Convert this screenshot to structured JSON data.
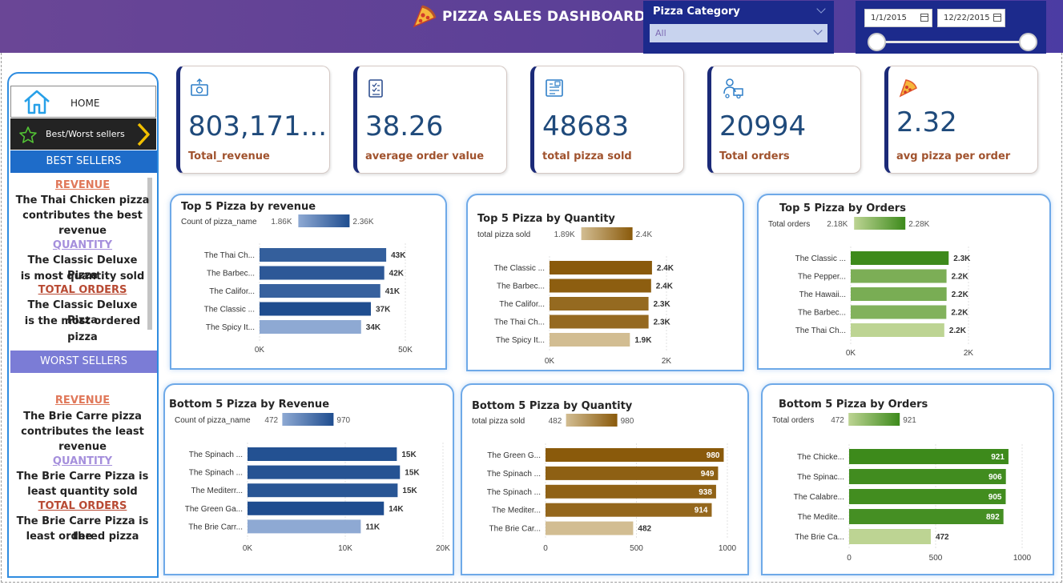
{
  "header": {
    "title": "PIZZA SALES DASHBOARD",
    "category_slicer": {
      "label": "Pizza Category",
      "value": "All"
    },
    "date_range": {
      "start": "1/1/2015",
      "end": "12/22/2015"
    }
  },
  "sidebar": {
    "home_label": "HOME",
    "bw_label": "Best/Worst sellers",
    "best_sellers": {
      "title": "BEST SELLERS",
      "revenue_head": "REVENUE",
      "revenue_lines": [
        "The Thai Chicken pizza",
        "contributes the best",
        "revenue"
      ],
      "quantity_head": "QUANTITY",
      "quantity_lines": [
        "The Classic Deluxe Pizza",
        "is most quantity sold"
      ],
      "orders_head": "TOTAL ORDERS",
      "orders_lines": [
        "The Classic Deluxe Pizza",
        "is the most ordered",
        "pizza"
      ]
    },
    "worst_sellers": {
      "title": "WORST SELLERS",
      "revenue_head": "REVENUE",
      "revenue_lines": [
        "The Brie Carre pizza",
        "contributes the least",
        "revenue"
      ],
      "quantity_head": "QUANTITY",
      "quantity_lines": [
        "The Brie Carre Pizza is",
        "least quantity sold"
      ],
      "orders_head": "TOTAL ORDERS",
      "orders_lines": [
        "The Brie Carre Pizza is the",
        "least ordered pizza"
      ]
    }
  },
  "kpis": [
    {
      "value": "803,171....",
      "label": "Total_revenue"
    },
    {
      "value": "38.26",
      "label": "average order value"
    },
    {
      "value": "48683",
      "label": "total pizza sold"
    },
    {
      "value": "20994",
      "label": "Total orders"
    },
    {
      "value": "2.32",
      "label": "avg pizza per order"
    }
  ],
  "colors": {
    "header": "#5a3f97",
    "slicer": "#1c2a8c",
    "blue_dark": "#1f4d8f",
    "blue_light": "#8ea9d3",
    "gold_dark": "#8a5a0b",
    "gold_light": "#d2bd92",
    "green_dark": "#3d8a1b",
    "green_light": "#bdd493",
    "kpi_label": "#a0522d"
  },
  "chart_data": [
    {
      "type": "bar",
      "orientation": "horizontal",
      "title": "Top 5 Pizza by revenue",
      "legend": {
        "label": "Count of pizza_name",
        "min_label": "1.86K",
        "max_label": "2.36K"
      },
      "categories": [
        "The Thai Ch...",
        "The Barbec...",
        "The Califor...",
        "The Classic ...",
        "The Spicy It..."
      ],
      "values": [
        43434,
        42768,
        41410,
        38180,
        34831
      ],
      "color_values": [
        2315,
        2350,
        2302,
        2416,
        1887
      ],
      "data_labels": [
        "43K",
        "42K",
        "41K",
        "37K",
        "34K"
      ],
      "xlim": [
        0,
        50000
      ],
      "xticks": [
        "0K",
        "50K"
      ],
      "palette": "blue"
    },
    {
      "type": "bar",
      "orientation": "horizontal",
      "title": "Top 5 Pizza by Quantity",
      "legend": {
        "label": "total pizza sold",
        "min_label": "1.89K",
        "max_label": "2.4K"
      },
      "categories": [
        "The Classic ...",
        "The Barbec...",
        "The Califor...",
        "The Thai Ch...",
        "The Spicy It..."
      ],
      "values": [
        2453,
        2432,
        2370,
        2371,
        1924
      ],
      "color_values": [
        2453,
        2432,
        2370,
        2371,
        1924
      ],
      "data_labels": [
        "2.4K",
        "2.4K",
        "2.3K",
        "2.3K",
        "1.9K"
      ],
      "xlim": [
        0,
        2800
      ],
      "xticks": [
        "0K",
        "2K"
      ],
      "palette": "gold"
    },
    {
      "type": "bar",
      "orientation": "horizontal",
      "title": "Top 5 Pizza by Orders",
      "legend": {
        "label": "Total orders",
        "min_label": "2.18K",
        "max_label": "2.28K"
      },
      "categories": [
        "The Classic ...",
        "The Pepper...",
        "The Hawaii...",
        "The Barbec...",
        "The Thai Ch..."
      ],
      "values": [
        2329,
        2278,
        2280,
        2273,
        2225
      ],
      "color_values": [
        2329,
        2278,
        2280,
        2273,
        2225
      ],
      "data_labels": [
        "2.3K",
        "2.2K",
        "2.2K",
        "2.2K",
        "2.2K"
      ],
      "xlim": [
        0,
        2800
      ],
      "xticks": [
        "0K",
        "2K"
      ],
      "palette": "green"
    },
    {
      "type": "bar",
      "orientation": "horizontal",
      "title": "Bottom 5 Pizza by Revenue",
      "legend": {
        "label": "Count of pizza_name",
        "min_label": "472",
        "max_label": "970"
      },
      "categories": [
        "The Spinach ...",
        "The Spinach ...",
        "The Mediterr...",
        "The Green Ga...",
        "The Brie Carr..."
      ],
      "values": [
        15277,
        15596,
        15360,
        13955,
        11588
      ],
      "color_values": [
        950,
        940,
        923,
        970,
        472
      ],
      "data_labels": [
        "15K",
        "15K",
        "15K",
        "14K",
        "11K"
      ],
      "xlim": [
        0,
        20000
      ],
      "xticks": [
        "0K",
        "10K",
        "20K"
      ],
      "palette": "blue"
    },
    {
      "type": "bar",
      "orientation": "horizontal",
      "title": "Bottom 5 Pizza by Quantity",
      "legend": {
        "label": "total pizza sold",
        "min_label": "482",
        "max_label": "980"
      },
      "categories": [
        "The Green G...",
        "The Spinach ...",
        "The Spinach ...",
        "The Mediter...",
        "The Brie Car..."
      ],
      "values": [
        980,
        949,
        938,
        914,
        482
      ],
      "color_values": [
        980,
        949,
        938,
        914,
        482
      ],
      "data_labels": [
        "980",
        "949",
        "938",
        "914",
        "482"
      ],
      "xlim": [
        0,
        1000
      ],
      "xticks": [
        "0",
        "500",
        "1000"
      ],
      "palette": "gold"
    },
    {
      "type": "bar",
      "orientation": "horizontal",
      "title": "Bottom 5 Pizza by Orders",
      "legend": {
        "label": "Total orders",
        "min_label": "472",
        "max_label": "921"
      },
      "categories": [
        "The Chicke...",
        "The Spinac...",
        "The Calabre...",
        "The Medite...",
        "The Brie Ca..."
      ],
      "values": [
        921,
        906,
        905,
        892,
        472
      ],
      "color_values": [
        921,
        906,
        905,
        892,
        472
      ],
      "data_labels": [
        "921",
        "906",
        "905",
        "892",
        "472"
      ],
      "xlim": [
        0,
        1000
      ],
      "xticks": [
        "0",
        "500",
        "1000"
      ],
      "palette": "green"
    }
  ]
}
